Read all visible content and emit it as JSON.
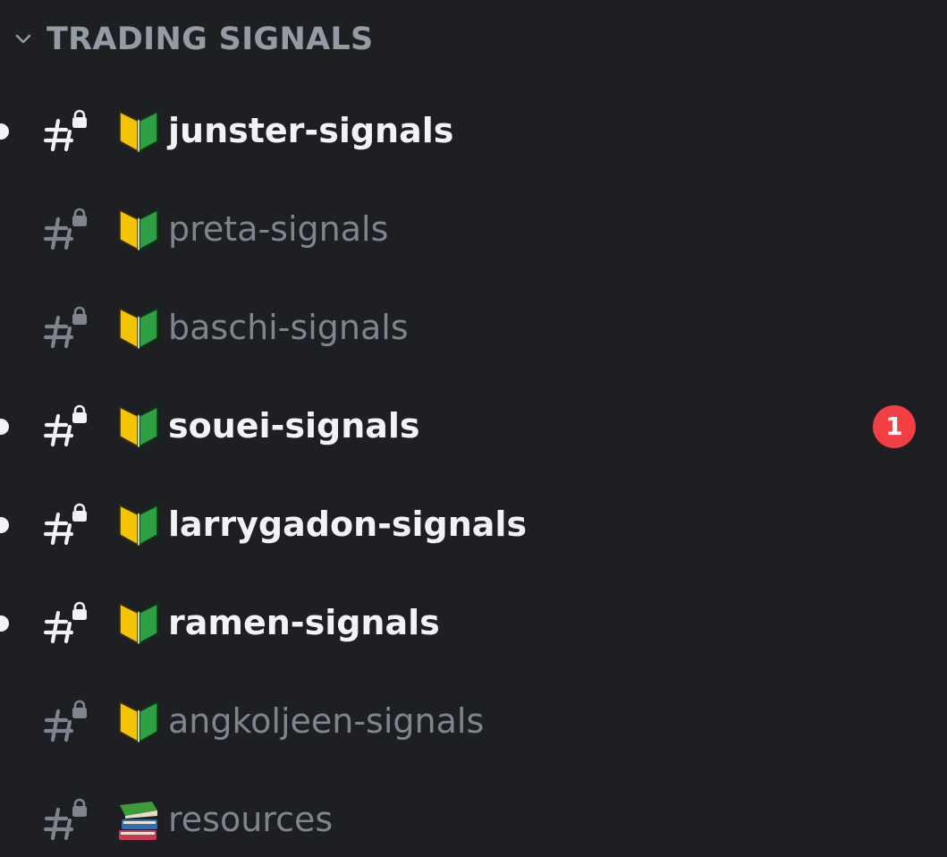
{
  "category": {
    "label": "TRADING SIGNALS",
    "collapse_icon": "chevron-down-icon",
    "color": "#949ba4"
  },
  "colors": {
    "background": "#1e1f22",
    "unread_text": "#f2f3f5",
    "read_text": "#80848e",
    "mention_badge": "#f23f43"
  },
  "channels": [
    {
      "name": "junster-signals",
      "icon": "locked-text-channel-icon",
      "emoji": "beginner-leaf-icon",
      "unread": true,
      "mentions": ""
    },
    {
      "name": "preta-signals",
      "icon": "locked-text-channel-icon",
      "emoji": "beginner-leaf-icon",
      "unread": false,
      "mentions": ""
    },
    {
      "name": "baschi-signals",
      "icon": "locked-text-channel-icon",
      "emoji": "beginner-leaf-icon",
      "unread": false,
      "mentions": ""
    },
    {
      "name": "souei-signals",
      "icon": "locked-text-channel-icon",
      "emoji": "beginner-leaf-icon",
      "unread": true,
      "mentions": "1"
    },
    {
      "name": "larrygadon-signals",
      "icon": "locked-text-channel-icon",
      "emoji": "beginner-leaf-icon",
      "unread": true,
      "mentions": ""
    },
    {
      "name": "ramen-signals",
      "icon": "locked-text-channel-icon",
      "emoji": "beginner-leaf-icon",
      "unread": true,
      "mentions": ""
    },
    {
      "name": "angkoljeen-signals",
      "icon": "locked-text-channel-icon",
      "emoji": "beginner-leaf-icon",
      "unread": false,
      "mentions": ""
    },
    {
      "name": "resources",
      "icon": "locked-text-channel-icon",
      "emoji": "books-icon",
      "unread": false,
      "mentions": ""
    }
  ]
}
